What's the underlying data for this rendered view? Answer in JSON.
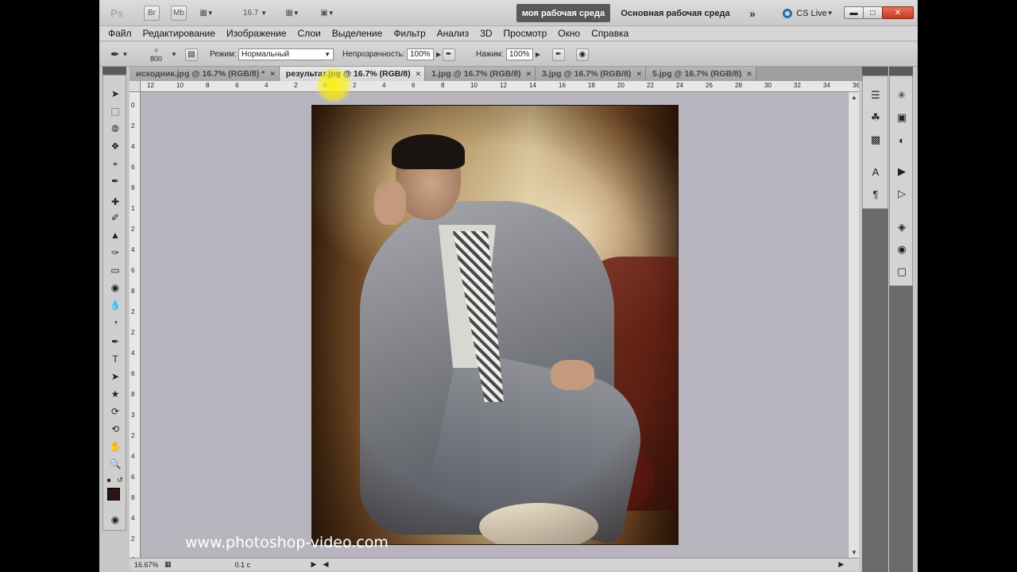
{
  "appbar": {
    "logo": "Ps",
    "br": "Br",
    "mb": "Mb",
    "zoom": "16.7",
    "workspace_active": "моя рабочая среда",
    "workspace_main": "Основная рабочая среда",
    "more": "»",
    "cslive": "CS Live"
  },
  "menu": [
    "Файл",
    "Редактирование",
    "Изображение",
    "Слои",
    "Выделение",
    "Фильтр",
    "Анализ",
    "3D",
    "Просмотр",
    "Окно",
    "Справка"
  ],
  "options": {
    "brush_size": "800",
    "mode_label": "Режим:",
    "mode_value": "Нормальный",
    "opacity_label": "Непрозрачность:",
    "opacity_value": "100%",
    "pressure_label": "Нажим:",
    "pressure_value": "100%"
  },
  "tabs": [
    {
      "label": "исходник.jpg @ 16.7% (RGB/8) *",
      "active": false
    },
    {
      "label": "результат.jpg @ 16.7% (RGB/8)",
      "active": true
    },
    {
      "label": "1.jpg @ 16.7% (RGB/8)",
      "active": false
    },
    {
      "label": "3.jpg @ 16.7% (RGB/8)",
      "active": false
    },
    {
      "label": "5.jpg @ 16.7% (RGB/8)",
      "active": false
    }
  ],
  "ruler_top": [
    "12",
    "10",
    "8",
    "6",
    "4",
    "2",
    "0",
    "2",
    "4",
    "6",
    "8",
    "10",
    "12",
    "14",
    "16",
    "18",
    "20",
    "22",
    "24",
    "26",
    "28",
    "30",
    "32",
    "34",
    "36"
  ],
  "ruler_left": [
    "0",
    "2",
    "4",
    "6",
    "8",
    "1",
    "2",
    "4",
    "6",
    "8",
    "2",
    "2",
    "4",
    "6",
    "8",
    "3",
    "2",
    "4",
    "6",
    "8",
    "4",
    "2",
    "4"
  ],
  "watermark": "www.photoshop-video.com",
  "status": {
    "zoom": "16.67%",
    "info": "0.1 c"
  },
  "colors": {
    "foreground": "#2a1510",
    "background": "#ffffff",
    "workspace_active_bg": "#595959"
  }
}
